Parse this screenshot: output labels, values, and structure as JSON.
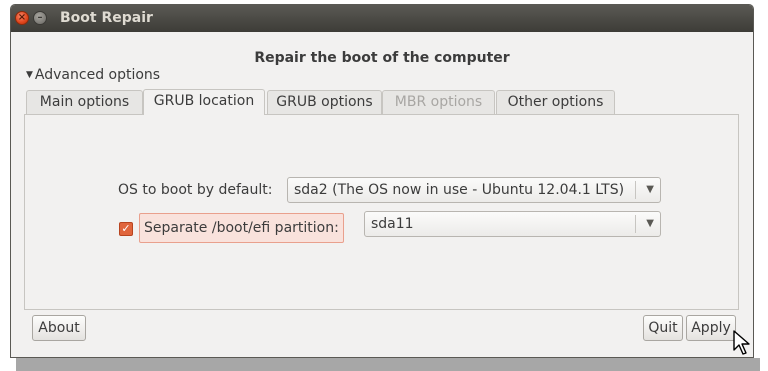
{
  "window": {
    "title": "Boot Repair"
  },
  "main": {
    "heading": "Repair the boot of the computer",
    "advanced_label": "Advanced options",
    "tabs": [
      {
        "label": "Main options",
        "state": "normal"
      },
      {
        "label": "GRUB location",
        "state": "active"
      },
      {
        "label": "GRUB options",
        "state": "normal"
      },
      {
        "label": "MBR options",
        "state": "disabled"
      },
      {
        "label": "Other options",
        "state": "normal"
      }
    ],
    "os_default": {
      "label": "OS to boot by default:",
      "value": "sda2 (The OS now in use - Ubuntu 12.04.1 LTS)"
    },
    "efi": {
      "checked": true,
      "label": "Separate /boot/efi partition:",
      "value": "sda11"
    }
  },
  "footer": {
    "about_label": "About",
    "quit_label": "Quit",
    "apply_label": "Apply"
  },
  "colors": {
    "titlebar": "#3c3b37",
    "window_bg": "#f2f1f0",
    "accent": "#e0653c"
  }
}
